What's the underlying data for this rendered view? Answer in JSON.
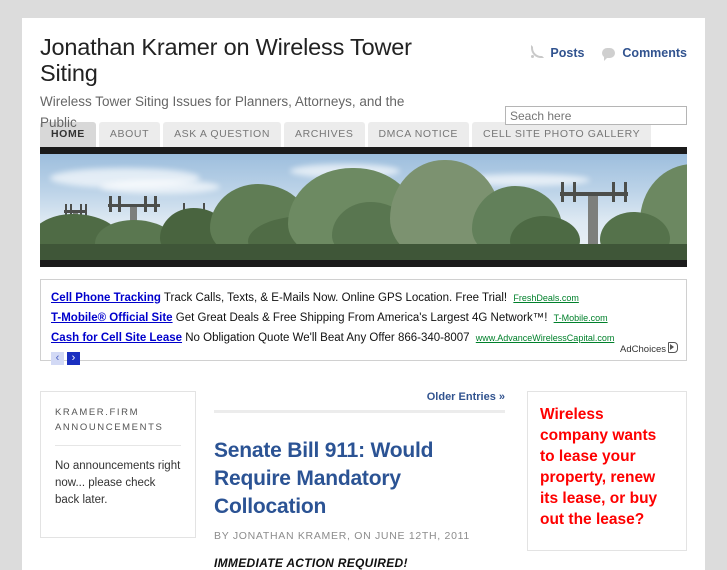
{
  "site": {
    "title": "Jonathan Kramer on Wireless Tower Siting",
    "description": "Wireless Tower Siting Issues for Planners, Attorneys, and the Public"
  },
  "feed": {
    "posts_label": "Posts",
    "comments_label": "Comments",
    "rss_icon": "rss-icon",
    "comment_icon": "comment-bubble-icon"
  },
  "search": {
    "placeholder": "Seach here",
    "value": ""
  },
  "nav": {
    "tabs": [
      {
        "label": "HOME",
        "active": true
      },
      {
        "label": "ABOUT",
        "active": false
      },
      {
        "label": "ASK A QUESTION",
        "active": false
      },
      {
        "label": "ARCHIVES",
        "active": false
      },
      {
        "label": "DMCA NOTICE",
        "active": false
      },
      {
        "label": "CELL SITE PHOTO GALLERY",
        "active": false
      }
    ]
  },
  "banner": {
    "alt": "cell-towers-among-trees-banner"
  },
  "ads": {
    "items": [
      {
        "title": "Cell Phone Tracking",
        "body": "Track Calls, Texts, & E-Mails Now. Online GPS Location. Free Trial!",
        "url": "FreshDeals.com"
      },
      {
        "title": "T-Mobile® Official Site",
        "body": "Get Great Deals & Free Shipping From America's Largest 4G Network™!",
        "url": "T-Mobile.com"
      },
      {
        "title": "Cash for Cell Site Lease",
        "body": "No Obligation Quote We'll Beat Any Offer 866-340-8007",
        "url": "www.AdvanceWirelessCapital.com"
      }
    ],
    "prev_label": "‹",
    "next_label": "›",
    "adchoices_label": "AdChoices"
  },
  "sidebar_left": {
    "widget_title": "KRAMER.FIRM ANNOUNCEMENTS",
    "widget_text": "No announcements right now... please check back later."
  },
  "main": {
    "older_entries_label": "Older Entries »",
    "post": {
      "title": "Senate Bill 911: Would Require Mandatory Collocation",
      "meta": "BY JONATHAN KRAMER, ON JUNE 12TH, 2011",
      "lead": "IMMEDIATE ACTION REQUIRED!"
    }
  },
  "sidebar_right": {
    "promo_text": "Wireless company wants to lease your property, renew its lease, or buy out the lease?"
  },
  "colors": {
    "page_background": "#dcdcdc",
    "content_background": "#ffffff",
    "link_blue": "#31538f",
    "post_title_blue": "#2b5394",
    "ad_title_blue": "#0000cc",
    "ad_url_green": "#00802b",
    "promo_red": "#fe0000",
    "nav_tab_bg": "#ececec",
    "nav_tab_active_bg": "#d8d8d8"
  }
}
